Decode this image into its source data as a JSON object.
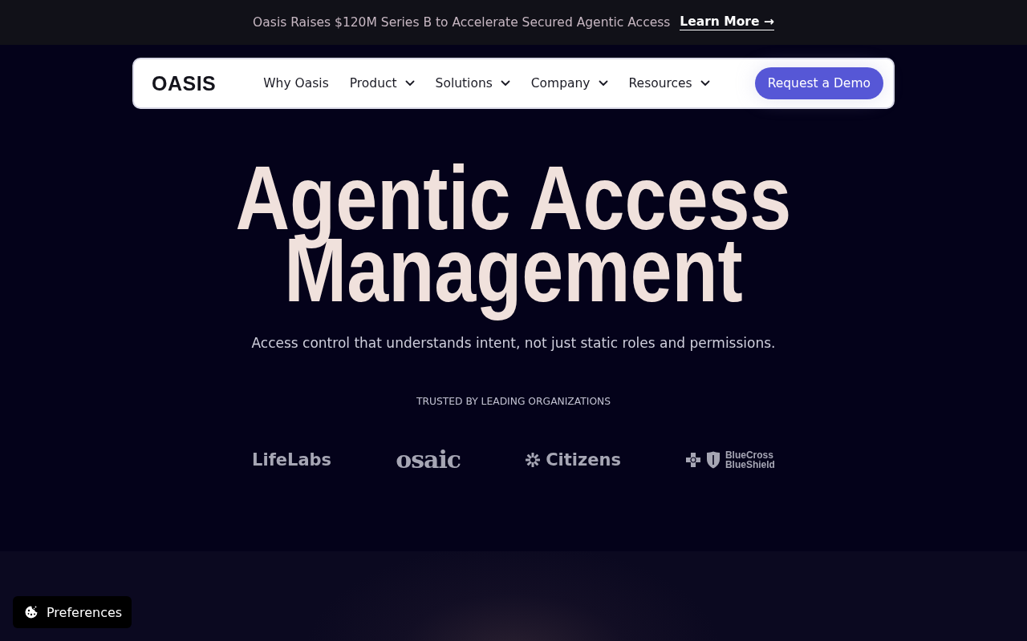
{
  "announcement": {
    "text": "Oasis Raises $120M Series B to Accelerate Secured Agentic Access",
    "link": "Learn More →"
  },
  "nav": {
    "logo": "OASIS",
    "items": [
      {
        "label": "Why Oasis",
        "kind": "link"
      },
      {
        "label": "Product",
        "kind": "dropdown"
      },
      {
        "label": "Solutions",
        "kind": "dropdown"
      },
      {
        "label": "Company",
        "kind": "dropdown"
      },
      {
        "label": "Resources",
        "kind": "dropdown"
      }
    ],
    "cta": "Request a Demo"
  },
  "hero": {
    "title": "Agentic Access Management",
    "subtitle": "Access control that understands intent, not just static roles and permissions."
  },
  "trusted": {
    "label": "TRUSTED BY LEADING ORGANIZATIONS",
    "logos": [
      {
        "text": "LifeLabs",
        "kind": "plain"
      },
      {
        "text": "osaic",
        "kind": "serif"
      },
      {
        "text": "Citizens",
        "kind": "burst"
      },
      {
        "text": "BlueCross BlueShield",
        "kind": "shield"
      }
    ]
  },
  "preferences": {
    "label": "Preferences"
  }
}
